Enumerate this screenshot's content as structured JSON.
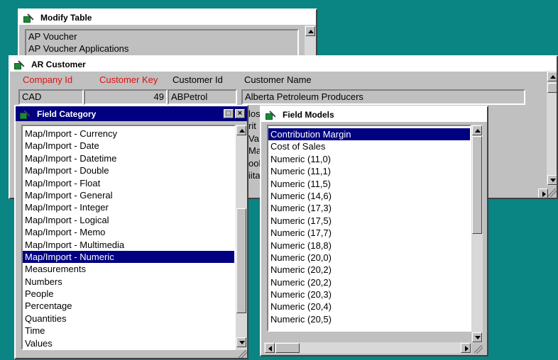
{
  "modify_table": {
    "title": "Modify Table",
    "items": [
      "AP Voucher",
      "AP Voucher Applications"
    ]
  },
  "ar_customer": {
    "title": "AR Customer",
    "headers": [
      "Company Id",
      "Customer Key",
      "Customer Id",
      "Customer Name"
    ],
    "header_colors": [
      "#e01010",
      "#e01010",
      "#000000",
      "#000000"
    ],
    "company_id": "CAD",
    "customer_key": "49",
    "customer_id": "ABPetrol",
    "customer_name": "Alberta Petroleum Producers",
    "partial_names": [
      "los",
      "rit",
      "Va",
      "Mar",
      "ool",
      "iita"
    ]
  },
  "field_category": {
    "title": "Field Category",
    "items": [
      "Map/Import - Currency",
      "Map/Import - Date",
      "Map/Import - Datetime",
      "Map/Import - Double",
      "Map/Import - Float",
      "Map/Import - General",
      "Map/Import - Integer",
      "Map/Import - Logical",
      "Map/Import - Memo",
      "Map/Import - Multimedia",
      "Map/Import - Numeric",
      "Measurements",
      "Numbers",
      "People",
      "Percentage",
      "Quantities",
      "Time",
      "Values"
    ],
    "selected": "Map/Import - Numeric",
    "restore_glyph": "□",
    "close_glyph": "×"
  },
  "field_models": {
    "title": "Field Models",
    "items": [
      "Contribution Margin",
      "Cost of Sales",
      "Numeric (11,0)",
      "Numeric (11,1)",
      "Numeric (11,5)",
      "Numeric (14,6)",
      "Numeric (17,3)",
      "Numeric (17,5)",
      "Numeric (17,7)",
      "Numeric (18,8)",
      "Numeric (20,0)",
      "Numeric (20,2)",
      "Numeric (20,2)",
      "Numeric (20,3)",
      "Numeric (20,4)",
      "Numeric (20,5)"
    ],
    "selected": "Contribution Margin"
  },
  "colors": {
    "desktop": "#0b8484",
    "active_title": "#000080",
    "required_label": "#e01010"
  }
}
